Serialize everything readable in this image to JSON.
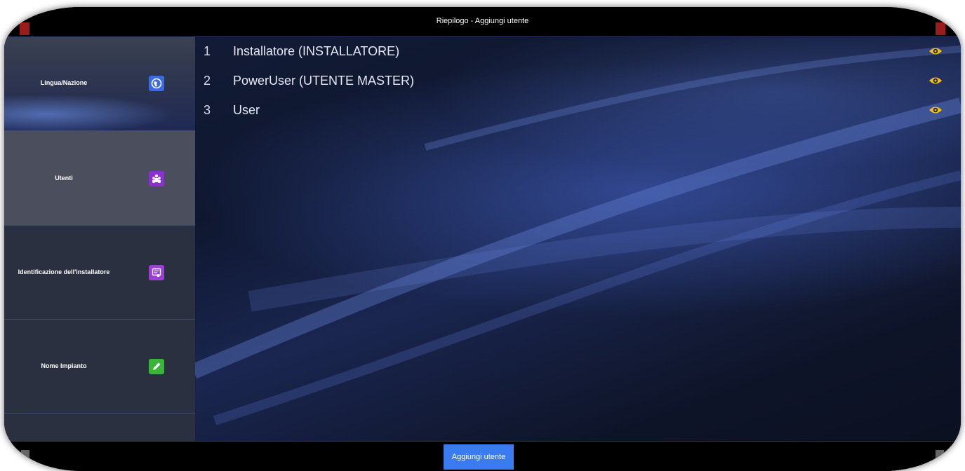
{
  "header": {
    "title": "Riepilogo - Aggiungi utente"
  },
  "sidebar": {
    "items": [
      {
        "label": "Lingua/Nazione",
        "icon": "globe-icon",
        "icon_color": "#3a6be0"
      },
      {
        "label": "Utenti",
        "icon": "users-icon",
        "icon_color": "#8a2fd1",
        "selected": true
      },
      {
        "label": "Identificazione dell'installatore",
        "icon": "id-badge-icon",
        "icon_color": "#9a3fd6"
      },
      {
        "label": "Nome Impianto",
        "icon": "edit-icon",
        "icon_color": "#3ab53a"
      }
    ],
    "nav": {
      "up_icon": "chevron-up-icon",
      "down_icon": "chevron-down-icon",
      "down_color": "#b21f1f"
    }
  },
  "users": [
    {
      "index": "1",
      "name": "Installatore (INSTALLATORE)"
    },
    {
      "index": "2",
      "name": "PowerUser (UTENTE MASTER)"
    },
    {
      "index": "3",
      "name": "User"
    }
  ],
  "footer": {
    "add_button_label": "Aggiungi utente",
    "add_button_color": "#3a7bf0"
  },
  "colors": {
    "eye_icon": "#f0c020"
  }
}
